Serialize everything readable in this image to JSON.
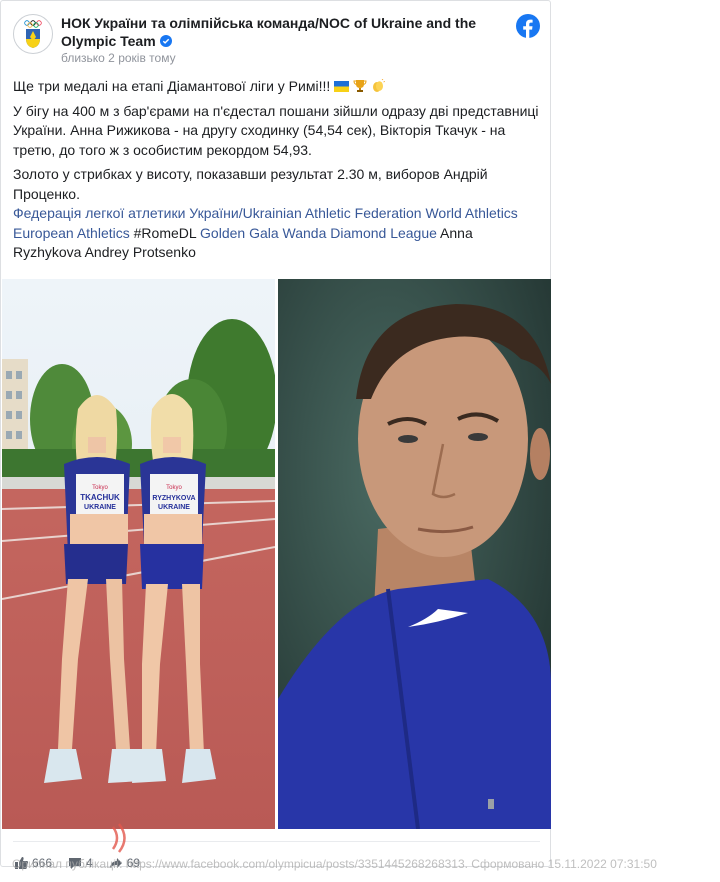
{
  "post": {
    "author": "НОК України та олімпійська команда/NOC of Ukraine and the Olympic Team",
    "time": "близько 2 років тому",
    "paragraph1": "Ще три медалі на етапі Діамантової ліги у Римі!!!",
    "paragraph1_emojis": [
      "ukraine-flag",
      "trophy",
      "clapping-hands"
    ],
    "paragraph2": "У бігу на 400 м з бар'єрами на п'єдестал пошани зійшли одразу дві представниці України. Анна Рижикова - на другу сходинку (54,54 сек), Вікторія Ткачук - на третю, до того ж з особистим рекордом 54,93.",
    "paragraph3": "Золото у стрибках у висоту, показавши результат 2.30 м, виборов Андрій Проценко.",
    "link1": "Федерація легкої атлетики України/Ukrainian Athletic Federation",
    "link2": "World Athletics",
    "link3": "European Athletics",
    "hashtag": "#RomeDL",
    "link4": "Golden Gala Wanda Diamond League",
    "tag_text": "Anna Ryzhykova Andrey Protsenko"
  },
  "photos": {
    "left": {
      "bib1_name": "TKACHUK",
      "bib1_country": "UKRAINE",
      "bib2_name": "RYZHYKOVA",
      "bib2_country": "UKRAINE",
      "bib_brand": "Tokyo"
    },
    "right": {}
  },
  "stats": {
    "likes": "666",
    "comments": "4",
    "shares": "69"
  },
  "source_text": "Оригінал публікації: https://www.facebook.com/olympicua/posts/3351445268268313. Сформовано 15.11.2022 07:31:50",
  "colors": {
    "link": "#385898",
    "facebook_blue": "#1877f2",
    "verified": "#1877f2",
    "track": "#c9605a",
    "jersey": "#27308f"
  }
}
